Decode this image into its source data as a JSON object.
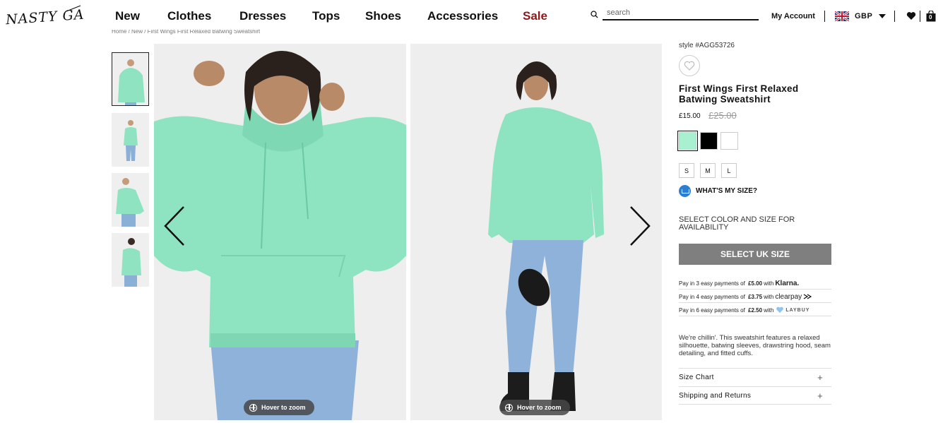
{
  "header": {
    "logo": "NASTY GAL",
    "nav": [
      "New",
      "Clothes",
      "Dresses",
      "Tops",
      "Shoes",
      "Accessories",
      "Sale"
    ],
    "sale_color": "#8b1a1a",
    "search_placeholder": "search",
    "account": "My Account",
    "currency": "GBP",
    "bag_count": "0"
  },
  "breadcrumb": "Home  /  New  /  First Wings First Relaxed Batwing Sweatshirt",
  "gallery": {
    "zoom_label": "Hover to zoom",
    "prev_icon": "chevron-left-icon",
    "next_icon": "chevron-right-icon"
  },
  "product": {
    "style": "style #AGG53726",
    "title": "First Wings First Relaxed Batwing Sweatshirt",
    "price": "£15.00",
    "old_price": "£25.00",
    "colors": [
      "#a8f0d0",
      "#000000",
      "#ffffff"
    ],
    "sizes": [
      "S",
      "M",
      "L"
    ],
    "whats_my_size": "WHAT'S MY SIZE?",
    "availability": "SELECT COLOR AND SIZE FOR AVAILABILITY",
    "select_button": "SELECT UK SIZE",
    "payments": [
      {
        "prefix": "Pay in 3 easy payments of",
        "amount": "£5.00",
        "with": "with",
        "brand": "Klarna."
      },
      {
        "prefix": "Pay in 4 easy payments of",
        "amount": "£3.75",
        "with": "with",
        "brand": "clearpay"
      },
      {
        "prefix": "Pay in 6 easy payments of",
        "amount": "£2.50",
        "with": "with",
        "brand": "LAYBUY"
      }
    ],
    "description": "We're chillin'. This sweatshirt features a relaxed silhouette, batwing sleeves, drawstring hood, seam detailing, and fitted cuffs.",
    "accordions": [
      "Size Chart",
      "Shipping and Returns"
    ]
  }
}
